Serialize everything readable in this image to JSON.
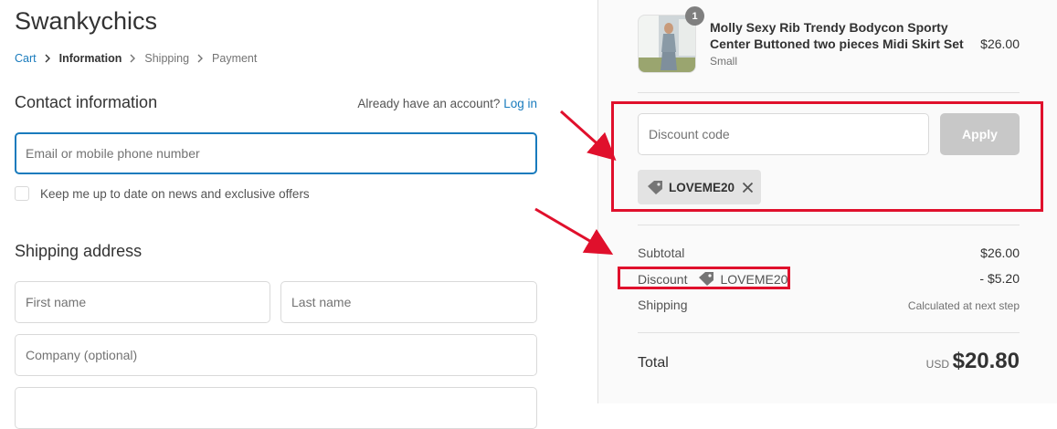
{
  "store": {
    "name": "Swankychics"
  },
  "breadcrumb": [
    {
      "label": "Cart",
      "state": "link"
    },
    {
      "label": "Information",
      "state": "current"
    },
    {
      "label": "Shipping",
      "state": "upcoming"
    },
    {
      "label": "Payment",
      "state": "upcoming"
    }
  ],
  "contact": {
    "title": "Contact information",
    "account_prompt": "Already have an account?",
    "login_label": "Log in",
    "email_placeholder": "Email or mobile phone number",
    "newsletter_label": "Keep me up to date on news and exclusive offers",
    "newsletter_checked": false
  },
  "shipping": {
    "title": "Shipping address",
    "first_name_placeholder": "First name",
    "last_name_placeholder": "Last name",
    "company_placeholder": "Company (optional)"
  },
  "order": {
    "item": {
      "name": "Molly Sexy Rib Trendy Bodycon Sporty Center Buttoned two pieces Midi Skirt Set",
      "variant": "Small",
      "price": "$26.00",
      "quantity": "1"
    },
    "discount": {
      "placeholder": "Discount code",
      "apply_label": "Apply",
      "applied_code": "LOVEME20"
    },
    "summary": {
      "subtotal_label": "Subtotal",
      "subtotal_value": "$26.00",
      "discount_label": "Discount",
      "discount_code": "LOVEME20",
      "discount_value": "- $5.20",
      "shipping_label": "Shipping",
      "shipping_value": "Calculated at next step",
      "total_label": "Total",
      "currency": "USD",
      "total_value": "$20.80"
    }
  },
  "colors": {
    "link": "#197bbd",
    "annotation": "#e0102c",
    "apply_disabled": "#c8c8c8"
  },
  "icons": [
    "chevron-right-icon",
    "tag-icon",
    "close-icon",
    "arrow-annotation"
  ]
}
